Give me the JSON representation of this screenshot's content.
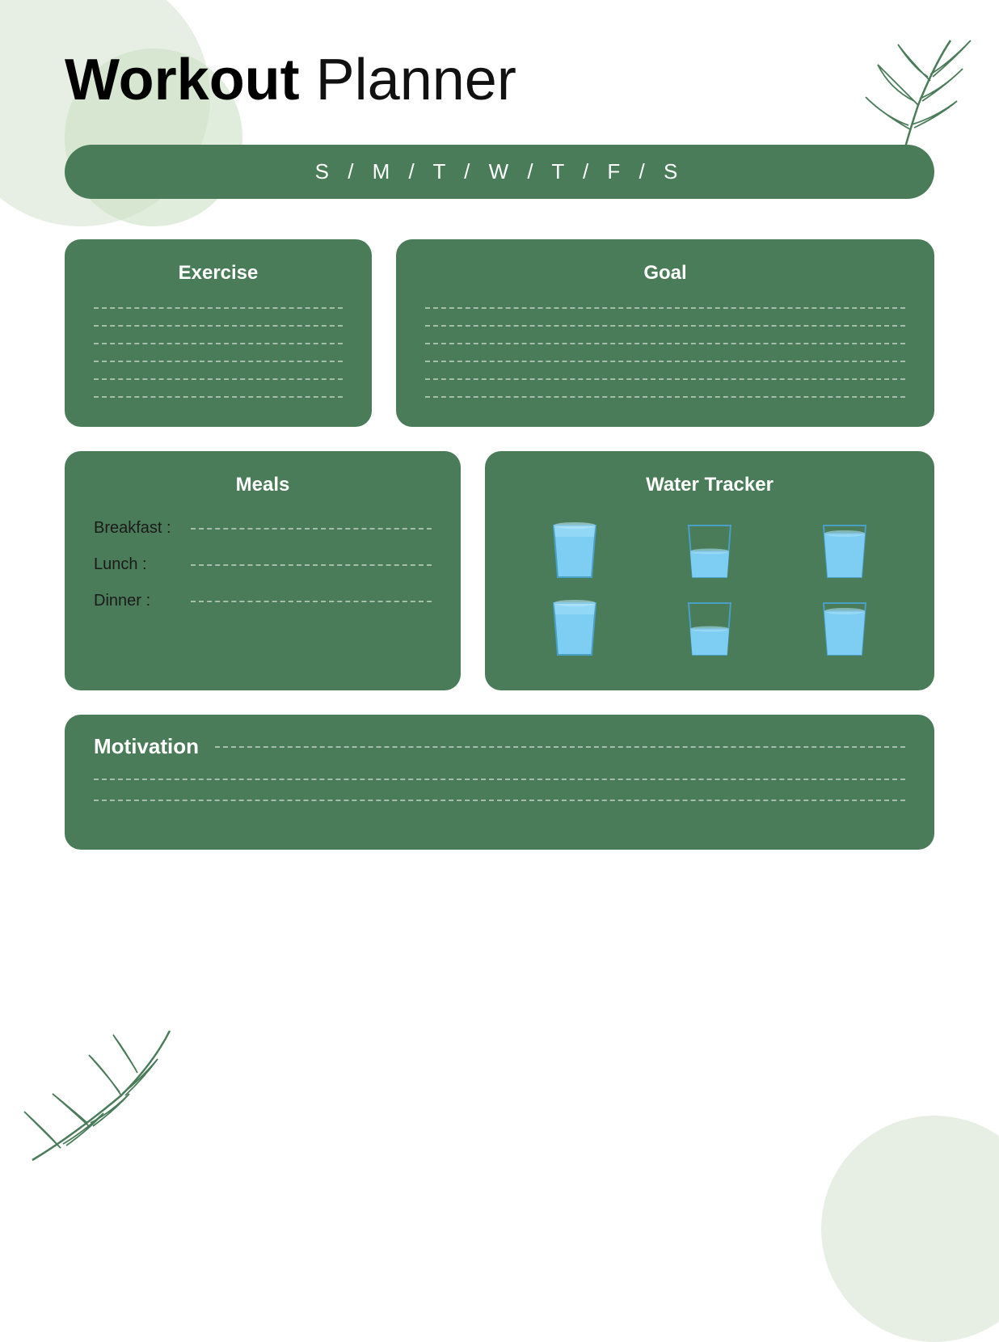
{
  "title": {
    "bold": "Workout",
    "light": " Planner"
  },
  "days_bar": {
    "text": "S  /  M  /  T  /  W  /  T  /  F  /  S"
  },
  "exercise_section": {
    "title": "Exercise",
    "lines_count": 6
  },
  "goal_section": {
    "title": "Goal",
    "lines_count": 6
  },
  "meals_section": {
    "title": "Meals",
    "breakfast_label": "Breakfast :",
    "lunch_label": "Lunch :",
    "dinner_label": "Dinner :"
  },
  "water_section": {
    "title": "Water Tracker",
    "glasses_count": 6
  },
  "motivation_section": {
    "title": "Motivation",
    "lines_count": 2
  },
  "colors": {
    "green": "#4a7c59",
    "light_green": "#dde8d8",
    "white": "#ffffff",
    "black": "#000000"
  }
}
